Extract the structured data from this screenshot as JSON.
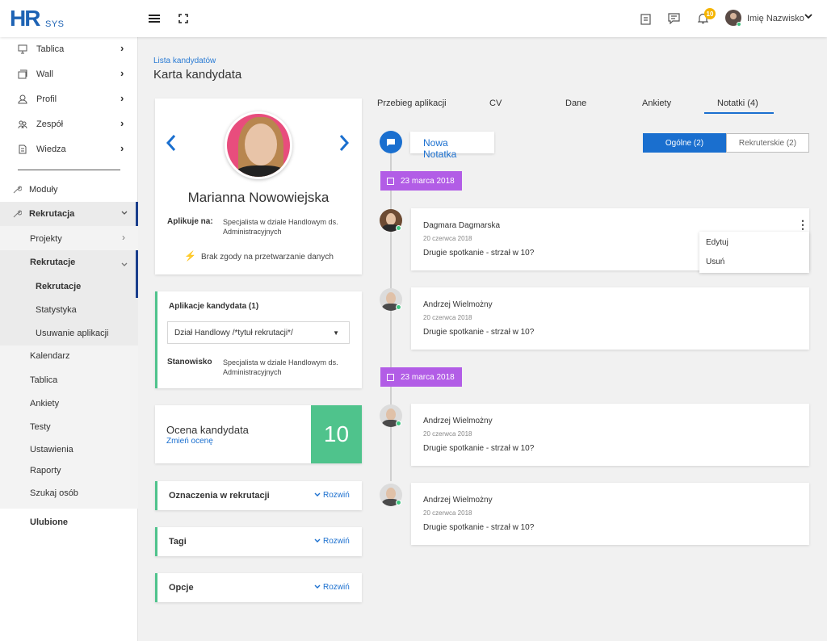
{
  "topbar": {
    "logo_main": "HR",
    "logo_sub": "SYS",
    "badge_count": "10",
    "user_name": "Imię Nazwisko"
  },
  "sidebar": {
    "items": [
      {
        "label": "Tablica",
        "icon": "monitor-icon"
      },
      {
        "label": "Wall",
        "icon": "wall-icon"
      },
      {
        "label": "Profil",
        "icon": "user-icon"
      },
      {
        "label": "Zespół",
        "icon": "team-icon"
      },
      {
        "label": "Wiedza",
        "icon": "document-icon"
      }
    ],
    "modules_label": "Moduły",
    "rekrutacja_label": "Rekrutacja",
    "sub": {
      "projekty": "Projekty",
      "rekrutacje_group": "Rekrutacje",
      "rekrutacje": "Rekrutacje",
      "statystyka": "Statystyka",
      "usuwanie": "Usuwanie aplikacji",
      "kalendarz": "Kalendarz",
      "tablica": "Tablica",
      "ankiety": "Ankiety",
      "testy": "Testy",
      "ustawienia": "Ustawienia",
      "raporty": "Raporty",
      "szukaj": "Szukaj osób"
    },
    "ulubione": "Ulubione"
  },
  "header": {
    "breadcrumb": "Lista kandydatów",
    "title": "Karta kandydata"
  },
  "profile": {
    "name": "Marianna Nowowiejska",
    "applies_label": "Aplikuje na:",
    "applies_value": "Specjalista w dziale Handlowym ds. Administracyjnych",
    "consent": "Brak zgody na przetwarzanie danych"
  },
  "applications": {
    "title": "Aplikacje kandydata (1)",
    "selected": "Dział Handlowy /*tytuł rekrutacji*/",
    "position_label": "Stanowisko",
    "position_value": "Specjalista w dziale Handlowym ds. Administracyjnych"
  },
  "rating": {
    "title": "Ocena kandydata",
    "change": "Zmień ocenę",
    "score": "10"
  },
  "sections": [
    {
      "title": "Oznaczenia w rekrutacji",
      "link": "Rozwiń"
    },
    {
      "title": "Tagi",
      "link": "Rozwiń"
    },
    {
      "title": "Opcje",
      "link": "Rozwiń"
    }
  ],
  "tabs": [
    "Przebieg aplikacji",
    "CV",
    "Dane",
    "Ankiety",
    "Notatki (4)"
  ],
  "notes": {
    "new_note": "Nowa Notatka",
    "filter_general": "Ogólne (2)",
    "filter_recruiter": "Rekruterskie (2)",
    "groups": [
      {
        "date": "23 marca 2018",
        "items": [
          {
            "author": "Dagmara Dagmarska",
            "date": "20 czerwca 2018",
            "text": "Drugie spotkanie - strzał w 10?"
          },
          {
            "author": "Andrzej Wielmożny",
            "date": "20 czerwca 2018",
            "text": "Drugie spotkanie - strzał w 10?"
          }
        ]
      },
      {
        "date": "23 marca 2018",
        "items": [
          {
            "author": "Andrzej Wielmożny",
            "date": "20 czerwca 2018",
            "text": "Drugie spotkanie - strzał w 10?"
          },
          {
            "author": "Andrzej Wielmożny",
            "date": "20 czerwca 2018",
            "text": "Drugie spotkanie - strzał w 10?"
          }
        ]
      }
    ],
    "menu": [
      "Edytuj",
      "Usuń"
    ]
  },
  "colors": {
    "accent": "#1a6fcf",
    "green": "#4fc38c",
    "purple": "#b25de6",
    "badge": "#f5b400"
  }
}
